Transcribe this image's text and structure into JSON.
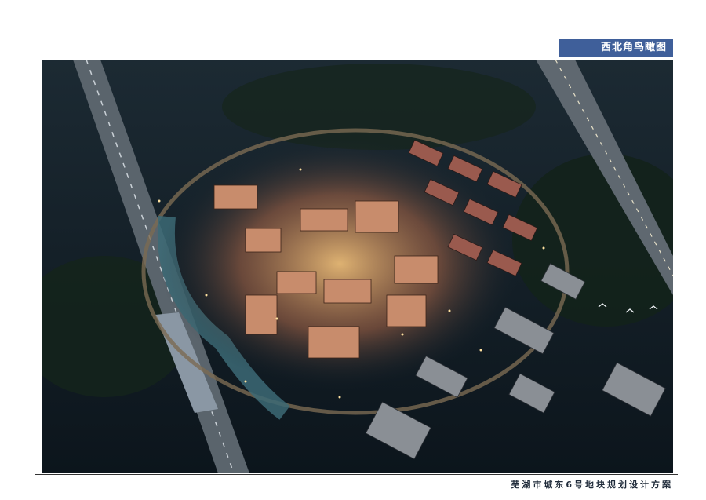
{
  "header": {
    "view_title": "西北角鸟瞰图"
  },
  "image": {
    "description_icon": "aerial-night-rendering"
  },
  "footer": {
    "caption": "芜湖市城东6号地块规划设计方案"
  },
  "colors": {
    "title_bg": "#3f5f9a",
    "rule": "#333333"
  }
}
